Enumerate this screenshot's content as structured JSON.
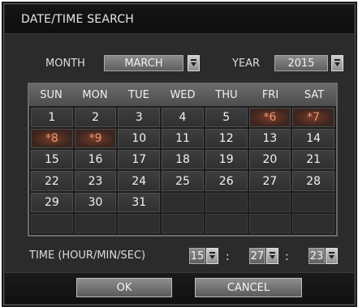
{
  "dialog": {
    "title": "DATE/TIME SEARCH",
    "month_label": "MONTH",
    "month_value": "MARCH",
    "year_label": "YEAR",
    "year_value": "2015",
    "time_label": "TIME (HOUR/MIN/SEC)",
    "hour": "15",
    "minute": "27",
    "second": "23",
    "time_separator": ":",
    "ok_label": "OK",
    "cancel_label": "CANCEL"
  },
  "calendar": {
    "weekdays": [
      "SUN",
      "MON",
      "TUE",
      "WED",
      "THU",
      "FRI",
      "SAT"
    ],
    "weeks": [
      [
        {
          "t": "1"
        },
        {
          "t": "2"
        },
        {
          "t": "3"
        },
        {
          "t": "4"
        },
        {
          "t": "5"
        },
        {
          "t": "*6",
          "h": true
        },
        {
          "t": "*7",
          "h": true
        }
      ],
      [
        {
          "t": "*8",
          "h": true
        },
        {
          "t": "*9",
          "h": true
        },
        {
          "t": "10"
        },
        {
          "t": "11"
        },
        {
          "t": "12"
        },
        {
          "t": "13"
        },
        {
          "t": "14"
        }
      ],
      [
        {
          "t": "15"
        },
        {
          "t": "16"
        },
        {
          "t": "17"
        },
        {
          "t": "18"
        },
        {
          "t": "19"
        },
        {
          "t": "20"
        },
        {
          "t": "21"
        }
      ],
      [
        {
          "t": "22"
        },
        {
          "t": "23"
        },
        {
          "t": "24"
        },
        {
          "t": "25"
        },
        {
          "t": "26"
        },
        {
          "t": "27"
        },
        {
          "t": "28"
        }
      ],
      [
        {
          "t": "29"
        },
        {
          "t": "30"
        },
        {
          "t": "31"
        },
        {
          "t": ""
        },
        {
          "t": ""
        },
        {
          "t": ""
        },
        {
          "t": ""
        }
      ],
      [
        {
          "t": ""
        },
        {
          "t": ""
        },
        {
          "t": ""
        },
        {
          "t": ""
        },
        {
          "t": ""
        },
        {
          "t": ""
        },
        {
          "t": ""
        }
      ]
    ]
  },
  "icons": {
    "dropdown": "chevron-down-icon"
  },
  "colors": {
    "background": "#2b2b2b",
    "cell": "#3a3a3a",
    "holiday_text": "#e89a70"
  }
}
